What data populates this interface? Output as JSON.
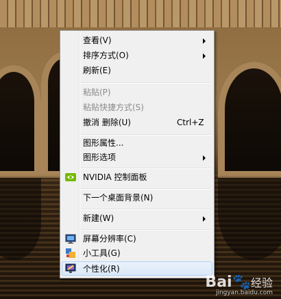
{
  "context_menu": {
    "items": [
      {
        "label": "查看(V)",
        "submenu": true,
        "disabled": false
      },
      {
        "label": "排序方式(O)",
        "submenu": true,
        "disabled": false
      },
      {
        "label": "刷新(E)",
        "submenu": false,
        "disabled": false
      },
      {
        "label": "粘贴(P)",
        "submenu": false,
        "disabled": true
      },
      {
        "label": "粘贴快捷方式(S)",
        "submenu": false,
        "disabled": true
      },
      {
        "label": "撤消 删除(U)",
        "shortcut": "Ctrl+Z",
        "submenu": false,
        "disabled": false
      },
      {
        "label": "图形属性...",
        "submenu": false,
        "disabled": false
      },
      {
        "label": "图形选项",
        "submenu": true,
        "disabled": false
      },
      {
        "label": "NVIDIA 控制面板",
        "icon": "nvidia-icon",
        "submenu": false,
        "disabled": false
      },
      {
        "label": "下一个桌面背景(N)",
        "submenu": false,
        "disabled": false
      },
      {
        "label": "新建(W)",
        "submenu": true,
        "disabled": false
      },
      {
        "label": "屏幕分辨率(C)",
        "icon": "monitor-resolution-icon",
        "submenu": false,
        "disabled": false
      },
      {
        "label": "小工具(G)",
        "icon": "gadgets-icon",
        "submenu": false,
        "disabled": false
      },
      {
        "label": "个性化(R)",
        "icon": "personalize-icon",
        "submenu": false,
        "disabled": false,
        "highlighted": true
      }
    ]
  },
  "watermark": {
    "logo": "Bai",
    "logo_suffix": "经验",
    "url": "jingyan.baidu.com"
  },
  "colors": {
    "menu_bg": "#f0f0f0",
    "disabled_text": "#8a8a8a",
    "highlight_border": "#aecff7",
    "nvidia_green": "#76b900"
  }
}
